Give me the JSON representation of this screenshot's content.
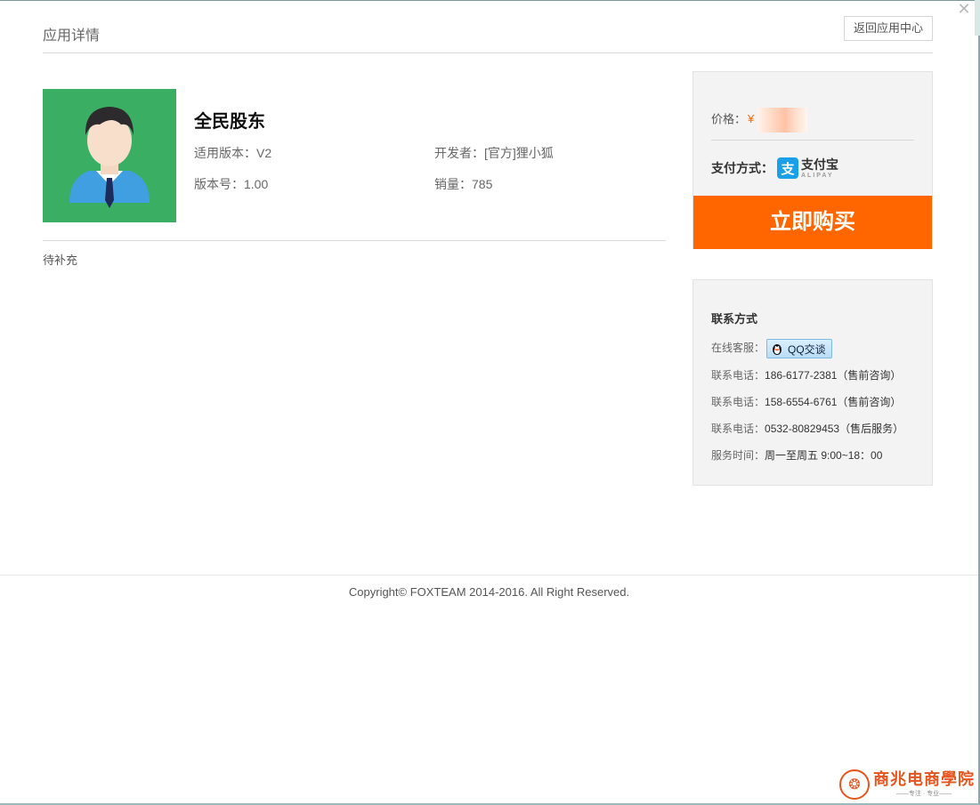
{
  "header": {
    "title": "应用详情",
    "back_label": "返回应用中心"
  },
  "app": {
    "name": "全民股东",
    "version_label": "适用版本：",
    "version_value": "V2",
    "developer_label": "开发者：",
    "developer_value": "[官方]狸小狐",
    "build_label": "版本号：",
    "build_value": "1.00",
    "sales_label": "销量：",
    "sales_value": "785",
    "description": "待补充"
  },
  "purchase": {
    "price_label": "价格：",
    "price_symbol": "¥",
    "payment_label": "支付方式：",
    "alipay_glyph": "支",
    "alipay_cn": "支付宝",
    "alipay_en": "ALIPAY",
    "buy_label": "立即购买"
  },
  "contact": {
    "title": "联系方式",
    "online_label": "在线客服：",
    "qq_label": "QQ交谈",
    "phones": [
      {
        "label": "联系电话：",
        "value": "186-6177-2381（售前咨询）"
      },
      {
        "label": "联系电话：",
        "value": "158-6554-6761（售前咨询）"
      },
      {
        "label": "联系电话：",
        "value": "0532-80829453（售后服务）"
      }
    ],
    "hours_label": "服务时间：",
    "hours_value": "周一至周五 9:00~18：00"
  },
  "footer": {
    "copyright": "Copyright© FOXTEAM 2014-2016. All Right Reserved."
  },
  "watermark": {
    "name": "商兆电商學院",
    "sub": "——专注 · 专业——"
  },
  "colors": {
    "accent_orange": "#ff6600",
    "icon_green": "#3aaf64",
    "alipay_blue": "#1aa0e8"
  },
  "icons": {
    "close": "close-icon",
    "qq": "qq-penguin-icon",
    "alipay": "alipay-logo-icon",
    "avatar": "user-avatar-icon"
  }
}
